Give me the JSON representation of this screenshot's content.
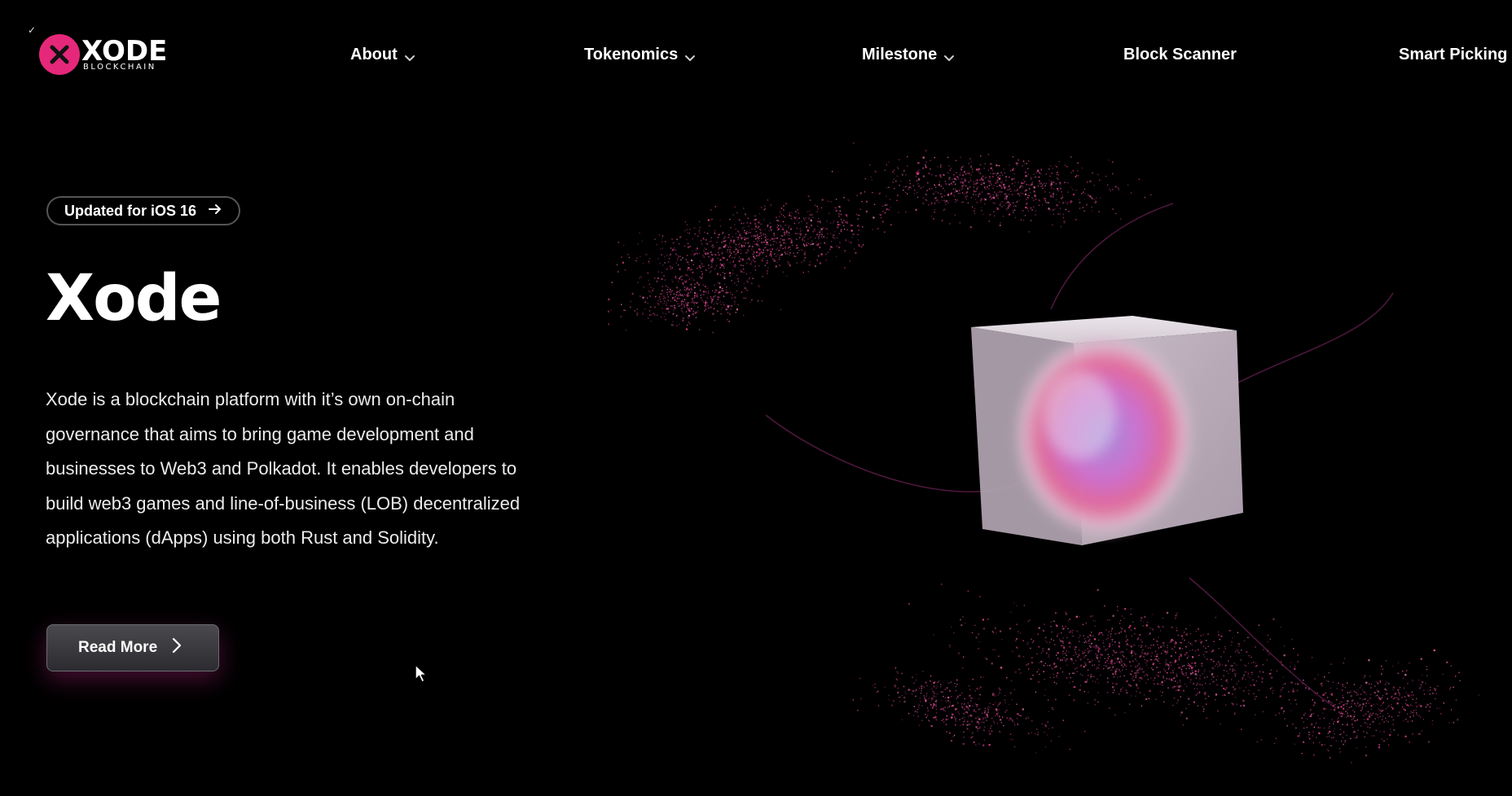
{
  "header": {
    "logo": {
      "word": "XODE",
      "sub": "BLOCKCHAIN"
    },
    "nav": [
      {
        "label": "About",
        "has_dropdown": true
      },
      {
        "label": "Tokenomics",
        "has_dropdown": true
      },
      {
        "label": "Milestone",
        "has_dropdown": true
      },
      {
        "label": "Block Scanner",
        "has_dropdown": false
      },
      {
        "label": "Smart Picking",
        "has_dropdown": false
      }
    ]
  },
  "hero": {
    "badge_label": "Updated for iOS 16",
    "title": "Xode",
    "description": "Xode is a blockchain platform with it’s own on-chain governance that aims to bring game development and businesses to Web3 and Polkadot. It enables developers to build web3 games and line-of-business (LOB) decentralized applications (dApps) using both Rust and Solidity.",
    "read_more_label": "Read More"
  },
  "colors": {
    "background": "#000000",
    "brand_pink": "#e6287a",
    "text": "#ffffff"
  },
  "icons": {
    "logo": "x-logo-icon",
    "dropdown": "chevron-down-icon",
    "badge_arrow": "arrow-right-icon",
    "button_arrow": "chevron-right-icon",
    "cursor": "mouse-pointer-icon",
    "art": "glass-cube-particles-illustration"
  }
}
